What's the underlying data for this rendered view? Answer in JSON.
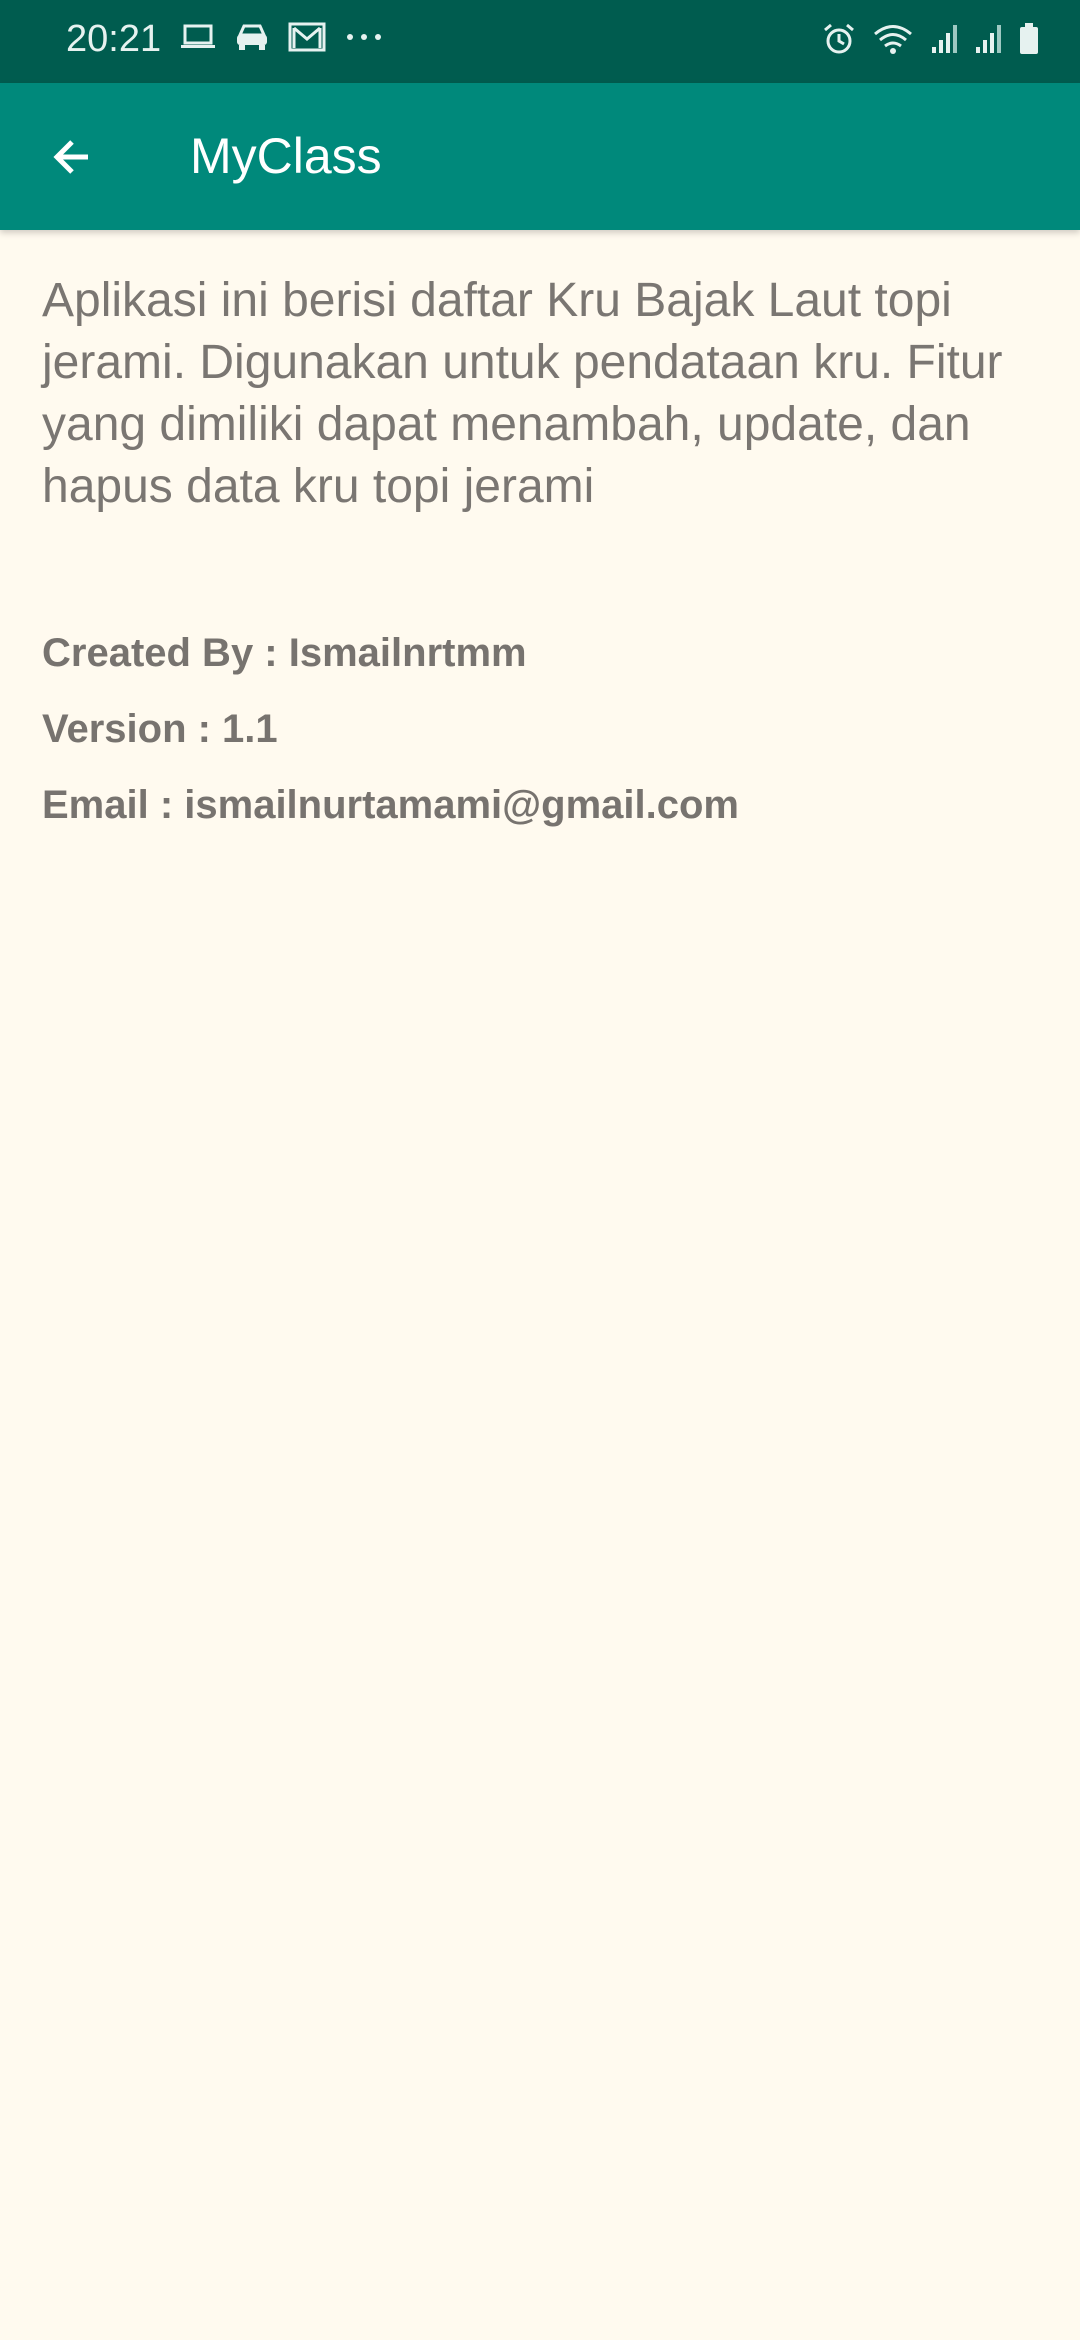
{
  "status_bar": {
    "time": "20:21",
    "left_icons": [
      "laptop-icon",
      "car-icon",
      "gmail-icon",
      "more-dots-icon"
    ],
    "right_icons": [
      "alarm-icon",
      "wifi-icon",
      "signal-icon",
      "signal-icon",
      "battery-icon"
    ],
    "background": "#005c4f"
  },
  "app_bar": {
    "title": "MyClass",
    "back_icon": "arrow-left-icon",
    "background": "#00897b"
  },
  "main": {
    "description": "Aplikasi ini berisi daftar Kru Bajak Laut topi jerami. Digunakan untuk pendataan kru. Fitur yang dimiliki dapat menambah, update, dan hapus data kru topi jerami",
    "created_by": "Created By : Ismailnrtmm",
    "version": "Version : 1.1",
    "email": "Email : ismailnurtamami@gmail.com"
  },
  "colors": {
    "page_background": "#fffaef",
    "text": "#7a7672"
  }
}
